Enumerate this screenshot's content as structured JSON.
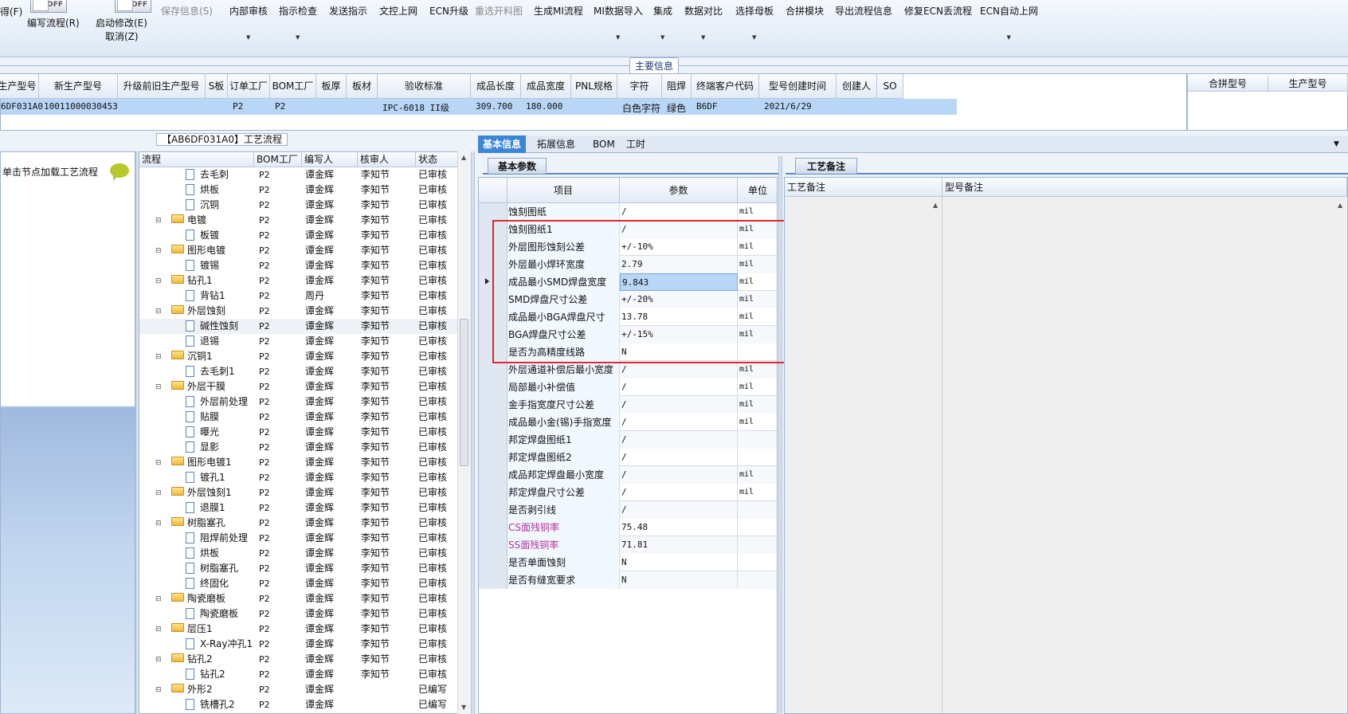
{
  "ribbon": {
    "partial_left": "得(F)",
    "toggle_off": "OFF",
    "edit_flow": "编写流程(R)",
    "auto_modify": "启动修改(E)",
    "cancel": "取消(Z)",
    "buttons": [
      {
        "label": "保存信息(S)",
        "disabled": true,
        "dropdown": false
      },
      {
        "label": "内部审核",
        "disabled": false,
        "dropdown": true
      },
      {
        "label": "指示检查",
        "disabled": false,
        "dropdown": true
      },
      {
        "label": "发送指示",
        "disabled": false,
        "dropdown": false
      },
      {
        "label": "文控上网",
        "disabled": false,
        "dropdown": false
      },
      {
        "label": "ECN升级",
        "disabled": false,
        "dropdown": false
      },
      {
        "label": "重选开料图",
        "disabled": true,
        "dropdown": false
      },
      {
        "label": "生成MI流程",
        "disabled": false,
        "dropdown": false
      },
      {
        "label": "MI数据导入",
        "disabled": false,
        "dropdown": true
      },
      {
        "label": "集成",
        "disabled": false,
        "dropdown": true
      },
      {
        "label": "数据对比",
        "disabled": false,
        "dropdown": true
      },
      {
        "label": "选择母板",
        "disabled": false,
        "dropdown": true
      },
      {
        "label": "合拼模块",
        "disabled": false,
        "dropdown": false
      },
      {
        "label": "导出流程信息",
        "disabled": false,
        "dropdown": false
      },
      {
        "label": "修复ECN丢流程",
        "disabled": false,
        "dropdown": false
      },
      {
        "label": "ECN自动上网",
        "disabled": false,
        "dropdown": true
      }
    ]
  },
  "main_info": {
    "tab": "主要信息",
    "headers": [
      "生产型号",
      "新生产型号",
      "升级前旧生产型号",
      "S板",
      "订单工厂",
      "BOM工厂",
      "板厚",
      "板材",
      "验收标准",
      "成品长度",
      "成品宽度",
      "PNL规格",
      "字符",
      "阻焊",
      "终端客户代码",
      "型号创建时间",
      "创建人",
      "SO"
    ],
    "row": [
      "6DF031A0",
      "10011000030453",
      "",
      "",
      "P2",
      "P2",
      "",
      "",
      "IPC-6018 II级",
      "309.700",
      "180.000",
      "",
      "白色字符",
      "绿色",
      "B6DF",
      "2021/6/29",
      "",
      ""
    ],
    "side_headers": [
      "合拼型号",
      "生产型号"
    ]
  },
  "left": {
    "title": "【AB6DF031A0】工艺流程",
    "hint": "单击节点加载工艺流程"
  },
  "tree": {
    "headers": [
      "流程",
      "BOM工厂",
      "编写人",
      "核审人",
      "状态"
    ],
    "rows": [
      {
        "name": "去毛刺",
        "level": 2,
        "f": "P2",
        "w": "谭金辉",
        "r": "李知节",
        "s": "已审核"
      },
      {
        "name": "烘板",
        "level": 2,
        "f": "P2",
        "w": "谭金辉",
        "r": "李知节",
        "s": "已审核"
      },
      {
        "name": "沉铜",
        "level": 2,
        "f": "P2",
        "w": "谭金辉",
        "r": "李知节",
        "s": "已审核"
      },
      {
        "name": "电镀",
        "level": 1,
        "f": "P2",
        "w": "谭金辉",
        "r": "李知节",
        "s": "已审核"
      },
      {
        "name": "板镀",
        "level": 2,
        "f": "P2",
        "w": "谭金辉",
        "r": "李知节",
        "s": "已审核"
      },
      {
        "name": "图形电镀",
        "level": 1,
        "f": "P2",
        "w": "谭金辉",
        "r": "李知节",
        "s": "已审核"
      },
      {
        "name": "镀锡",
        "level": 2,
        "f": "P2",
        "w": "谭金辉",
        "r": "李知节",
        "s": "已审核"
      },
      {
        "name": "钻孔1",
        "level": 1,
        "f": "P2",
        "w": "谭金辉",
        "r": "李知节",
        "s": "已审核"
      },
      {
        "name": "背钻1",
        "level": 2,
        "f": "P2",
        "w": "周丹",
        "r": "李知节",
        "s": "已审核"
      },
      {
        "name": "外层蚀刻",
        "level": 1,
        "f": "P2",
        "w": "谭金辉",
        "r": "李知节",
        "s": "已审核"
      },
      {
        "name": "碱性蚀刻",
        "level": 2,
        "f": "P2",
        "w": "谭金辉",
        "r": "李知节",
        "s": "已审核",
        "sel": true
      },
      {
        "name": "退锡",
        "level": 2,
        "f": "P2",
        "w": "谭金辉",
        "r": "李知节",
        "s": "已审核"
      },
      {
        "name": "沉铜1",
        "level": 1,
        "f": "P2",
        "w": "谭金辉",
        "r": "李知节",
        "s": "已审核"
      },
      {
        "name": "去毛刺1",
        "level": 2,
        "f": "P2",
        "w": "谭金辉",
        "r": "李知节",
        "s": "已审核"
      },
      {
        "name": "外层干膜",
        "level": 1,
        "f": "P2",
        "w": "谭金辉",
        "r": "李知节",
        "s": "已审核"
      },
      {
        "name": "外层前处理",
        "level": 2,
        "f": "P2",
        "w": "谭金辉",
        "r": "李知节",
        "s": "已审核"
      },
      {
        "name": "贴膜",
        "level": 2,
        "f": "P2",
        "w": "谭金辉",
        "r": "李知节",
        "s": "已审核"
      },
      {
        "name": "曝光",
        "level": 2,
        "f": "P2",
        "w": "谭金辉",
        "r": "李知节",
        "s": "已审核"
      },
      {
        "name": "显影",
        "level": 2,
        "f": "P2",
        "w": "谭金辉",
        "r": "李知节",
        "s": "已审核"
      },
      {
        "name": "图形电镀1",
        "level": 1,
        "f": "P2",
        "w": "谭金辉",
        "r": "李知节",
        "s": "已审核"
      },
      {
        "name": "镀孔1",
        "level": 2,
        "f": "P2",
        "w": "谭金辉",
        "r": "李知节",
        "s": "已审核"
      },
      {
        "name": "外层蚀刻1",
        "level": 1,
        "f": "P2",
        "w": "谭金辉",
        "r": "李知节",
        "s": "已审核"
      },
      {
        "name": "退膜1",
        "level": 2,
        "f": "P2",
        "w": "谭金辉",
        "r": "李知节",
        "s": "已审核"
      },
      {
        "name": "树脂塞孔",
        "level": 1,
        "f": "P2",
        "w": "谭金辉",
        "r": "李知节",
        "s": "已审核"
      },
      {
        "name": "阻焊前处理",
        "level": 2,
        "f": "P2",
        "w": "谭金辉",
        "r": "李知节",
        "s": "已审核"
      },
      {
        "name": "烘板",
        "level": 2,
        "f": "P2",
        "w": "谭金辉",
        "r": "李知节",
        "s": "已审核"
      },
      {
        "name": "树脂塞孔",
        "level": 2,
        "f": "P2",
        "w": "谭金辉",
        "r": "李知节",
        "s": "已审核"
      },
      {
        "name": "终固化",
        "level": 2,
        "f": "P2",
        "w": "谭金辉",
        "r": "李知节",
        "s": "已审核"
      },
      {
        "name": "陶瓷磨板",
        "level": 1,
        "f": "P2",
        "w": "谭金辉",
        "r": "李知节",
        "s": "已审核"
      },
      {
        "name": "陶瓷磨板",
        "level": 2,
        "f": "P2",
        "w": "谭金辉",
        "r": "李知节",
        "s": "已审核"
      },
      {
        "name": "层压1",
        "level": 1,
        "f": "P2",
        "w": "谭金辉",
        "r": "李知节",
        "s": "已审核"
      },
      {
        "name": "X-Ray冲孔1",
        "level": 2,
        "f": "P2",
        "w": "谭金辉",
        "r": "李知节",
        "s": "已审核"
      },
      {
        "name": "钻孔2",
        "level": 1,
        "f": "P2",
        "w": "谭金辉",
        "r": "李知节",
        "s": "已审核"
      },
      {
        "name": "钻孔2",
        "level": 2,
        "f": "P2",
        "w": "谭金辉",
        "r": "李知节",
        "s": "已审核"
      },
      {
        "name": "外形2",
        "level": 1,
        "f": "P2",
        "w": "谭金辉",
        "r": "",
        "s": "已编写"
      },
      {
        "name": "铣槽孔2",
        "level": 2,
        "f": "P2",
        "w": "谭金辉",
        "r": "",
        "s": "已编写"
      }
    ]
  },
  "detail_tabs": [
    "基本信息",
    "拓展信息",
    "BOM",
    "工时"
  ],
  "params": {
    "tab": "基本参数",
    "headers": [
      "项目",
      "参数",
      "单位"
    ],
    "rows": [
      {
        "k": "蚀刻图纸",
        "v": "/",
        "u": "mil"
      },
      {
        "k": "蚀刻图纸1",
        "v": "/",
        "u": "mil"
      },
      {
        "k": "外层图形蚀刻公差",
        "v": "+/-10%",
        "u": "mil"
      },
      {
        "k": "外层最小焊环宽度",
        "v": "2.79",
        "u": "mil"
      },
      {
        "k": "成品最小SMD焊盘宽度",
        "v": "9.843",
        "u": "mil",
        "current": true
      },
      {
        "k": "SMD焊盘尺寸公差",
        "v": "+/-20%",
        "u": "mil"
      },
      {
        "k": "成品最小BGA焊盘尺寸",
        "v": "13.78",
        "u": "mil"
      },
      {
        "k": "BGA焊盘尺寸公差",
        "v": "+/-15%",
        "u": "mil"
      },
      {
        "k": "是否为高精度线路",
        "v": "N",
        "u": ""
      },
      {
        "k": "外层通道补偿后最小宽度",
        "v": "/",
        "u": "mil"
      },
      {
        "k": "局部最小补偿值",
        "v": "/",
        "u": "mil"
      },
      {
        "k": "金手指宽度尺寸公差",
        "v": "/",
        "u": "mil"
      },
      {
        "k": "成品最小金(锡)手指宽度",
        "v": "/",
        "u": "mil"
      },
      {
        "k": "邦定焊盘图纸1",
        "v": "/",
        "u": ""
      },
      {
        "k": "邦定焊盘图纸2",
        "v": "/",
        "u": ""
      },
      {
        "k": "成品邦定焊盘最小宽度",
        "v": "/",
        "u": "mil"
      },
      {
        "k": "邦定焊盘尺寸公差",
        "v": "/",
        "u": "mil"
      },
      {
        "k": "是否剥引线",
        "v": "/",
        "u": ""
      },
      {
        "k": "CS面残铜率",
        "v": "75.48",
        "u": "",
        "mag": true
      },
      {
        "k": "SS面残铜率",
        "v": "71.81",
        "u": "",
        "mag": true
      },
      {
        "k": "是否单面蚀刻",
        "v": "N",
        "u": ""
      },
      {
        "k": "是否有缝宽要求",
        "v": "N",
        "u": ""
      }
    ]
  },
  "remarks": {
    "tab": "工艺备注",
    "headers": [
      "工艺备注",
      "型号备注"
    ]
  },
  "colors": {
    "selection": "#b8d6f6",
    "accent": "#3c86d6",
    "highlight_box": "#e0282e",
    "magenta_label": "#b0349a"
  }
}
